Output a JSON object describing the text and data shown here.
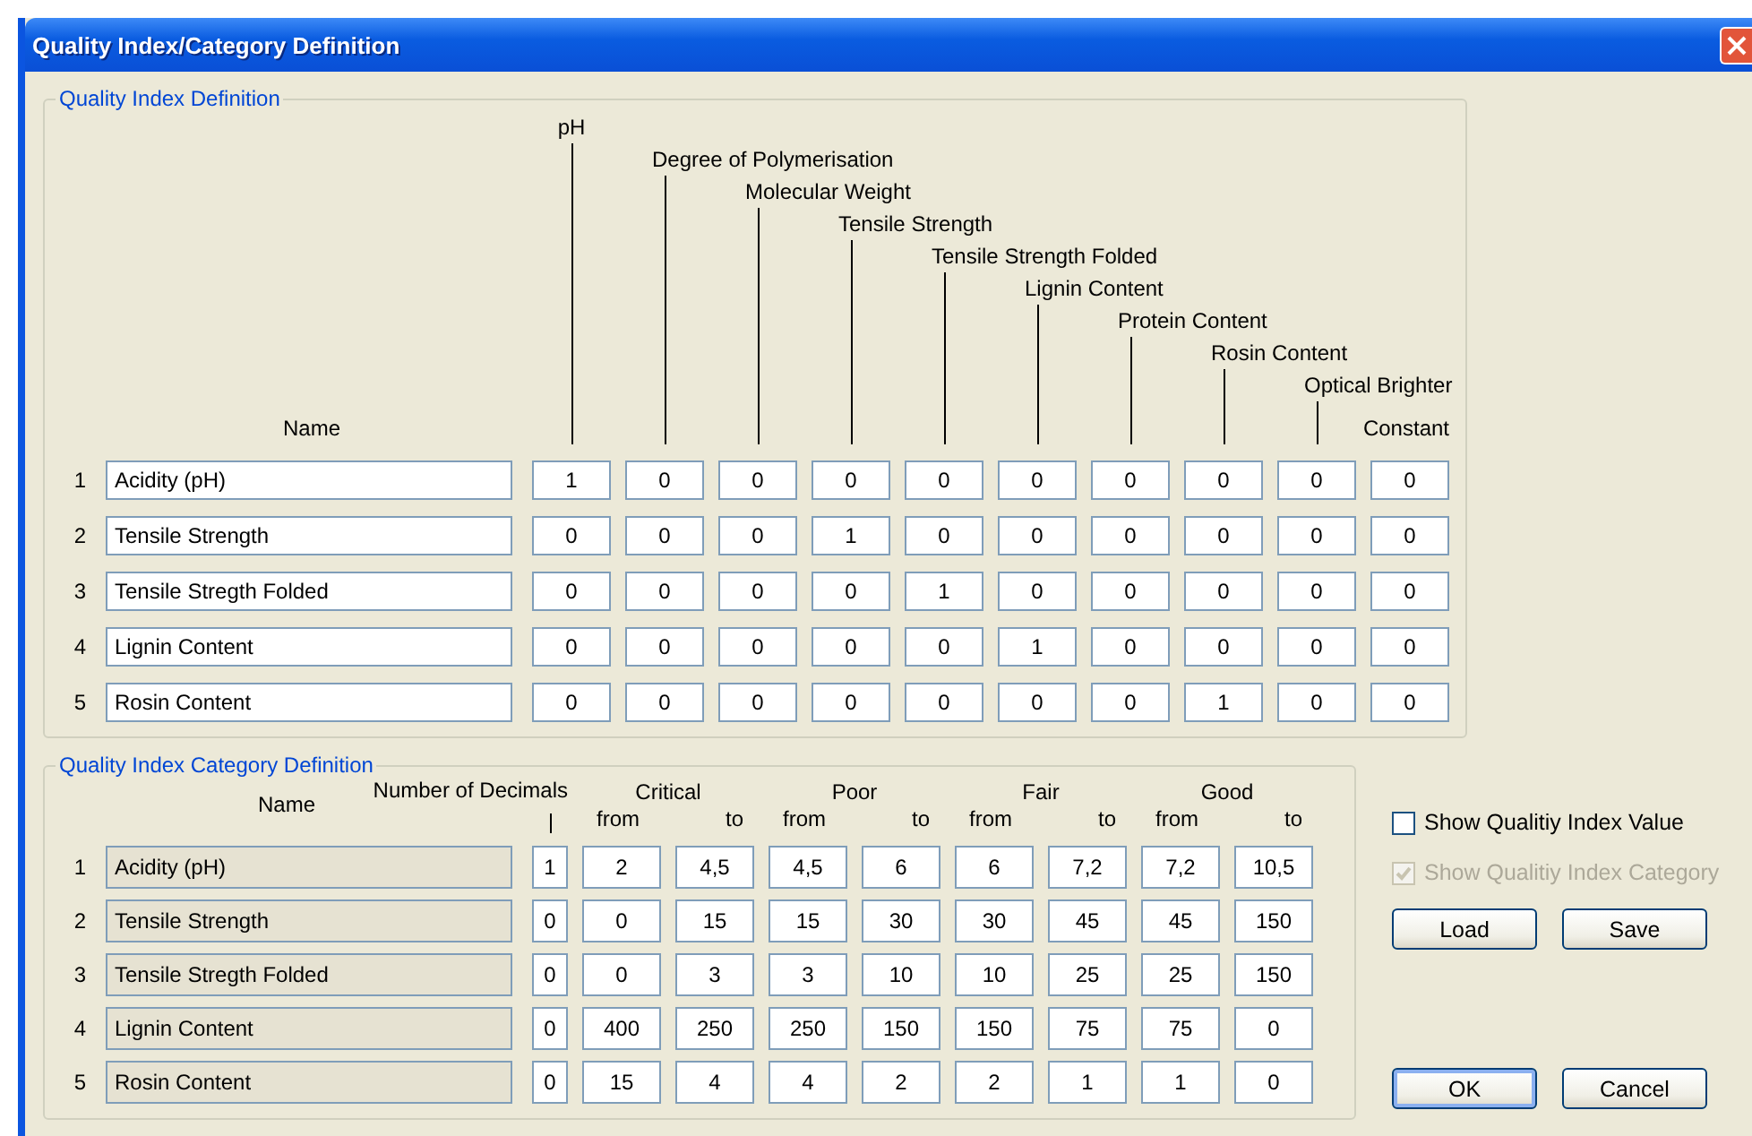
{
  "window": {
    "title": "Quality Index/Category Definition"
  },
  "index_definition": {
    "legend": "Quality Index Definition",
    "name_header": "Name",
    "columns": [
      "pH",
      "Degree of Polymerisation",
      "Molecular Weight",
      "Tensile Strength",
      "Tensile Strength Folded",
      "Lignin Content",
      "Protein Content",
      "Rosin Content",
      "Optical Brighter",
      "Constant"
    ],
    "rows": [
      {
        "number": "1",
        "name": "Acidity (pH)",
        "values": [
          "1",
          "0",
          "0",
          "0",
          "0",
          "0",
          "0",
          "0",
          "0",
          "0"
        ]
      },
      {
        "number": "2",
        "name": "Tensile Strength",
        "values": [
          "0",
          "0",
          "0",
          "1",
          "0",
          "0",
          "0",
          "0",
          "0",
          "0"
        ]
      },
      {
        "number": "3",
        "name": "Tensile Stregth Folded",
        "values": [
          "0",
          "0",
          "0",
          "0",
          "1",
          "0",
          "0",
          "0",
          "0",
          "0"
        ]
      },
      {
        "number": "4",
        "name": "Lignin Content",
        "values": [
          "0",
          "0",
          "0",
          "0",
          "0",
          "1",
          "0",
          "0",
          "0",
          "0"
        ]
      },
      {
        "number": "5",
        "name": "Rosin Content",
        "values": [
          "0",
          "0",
          "0",
          "0",
          "0",
          "0",
          "0",
          "1",
          "0",
          "0"
        ]
      }
    ]
  },
  "category_definition": {
    "legend": "Quality Index Category Definition",
    "name_header": "Name",
    "decimals_header": "Number of Decimals",
    "groups": [
      {
        "label": "Critical",
        "from": "from",
        "to": "to"
      },
      {
        "label": "Poor",
        "from": "from",
        "to": "to"
      },
      {
        "label": "Fair",
        "from": "from",
        "to": "to"
      },
      {
        "label": "Good",
        "from": "from",
        "to": "to"
      }
    ],
    "rows": [
      {
        "number": "1",
        "name": "Acidity (pH)",
        "decimals": "1",
        "values": [
          "2",
          "4,5",
          "4,5",
          "6",
          "6",
          "7,2",
          "7,2",
          "10,5"
        ]
      },
      {
        "number": "2",
        "name": "Tensile Strength",
        "decimals": "0",
        "values": [
          "0",
          "15",
          "15",
          "30",
          "30",
          "45",
          "45",
          "150"
        ]
      },
      {
        "number": "3",
        "name": "Tensile Stregth Folded",
        "decimals": "0",
        "values": [
          "0",
          "3",
          "3",
          "10",
          "10",
          "25",
          "25",
          "150"
        ]
      },
      {
        "number": "4",
        "name": "Lignin Content",
        "decimals": "0",
        "values": [
          "400",
          "250",
          "250",
          "150",
          "150",
          "75",
          "75",
          "0"
        ]
      },
      {
        "number": "5",
        "name": "Rosin Content",
        "decimals": "0",
        "values": [
          "15",
          "4",
          "4",
          "2",
          "2",
          "1",
          "1",
          "0"
        ]
      }
    ]
  },
  "options": [
    {
      "label": "Show Qualitiy Index Value",
      "checked": false,
      "disabled": false
    },
    {
      "label": "Show Qualitiy Index Category",
      "checked": true,
      "disabled": true
    }
  ],
  "file_buttons": [
    {
      "label": "Load",
      "default": false
    },
    {
      "label": "Save",
      "default": false
    }
  ],
  "dialog_buttons": [
    {
      "label": "OK",
      "default": true
    },
    {
      "label": "Cancel",
      "default": false
    }
  ]
}
